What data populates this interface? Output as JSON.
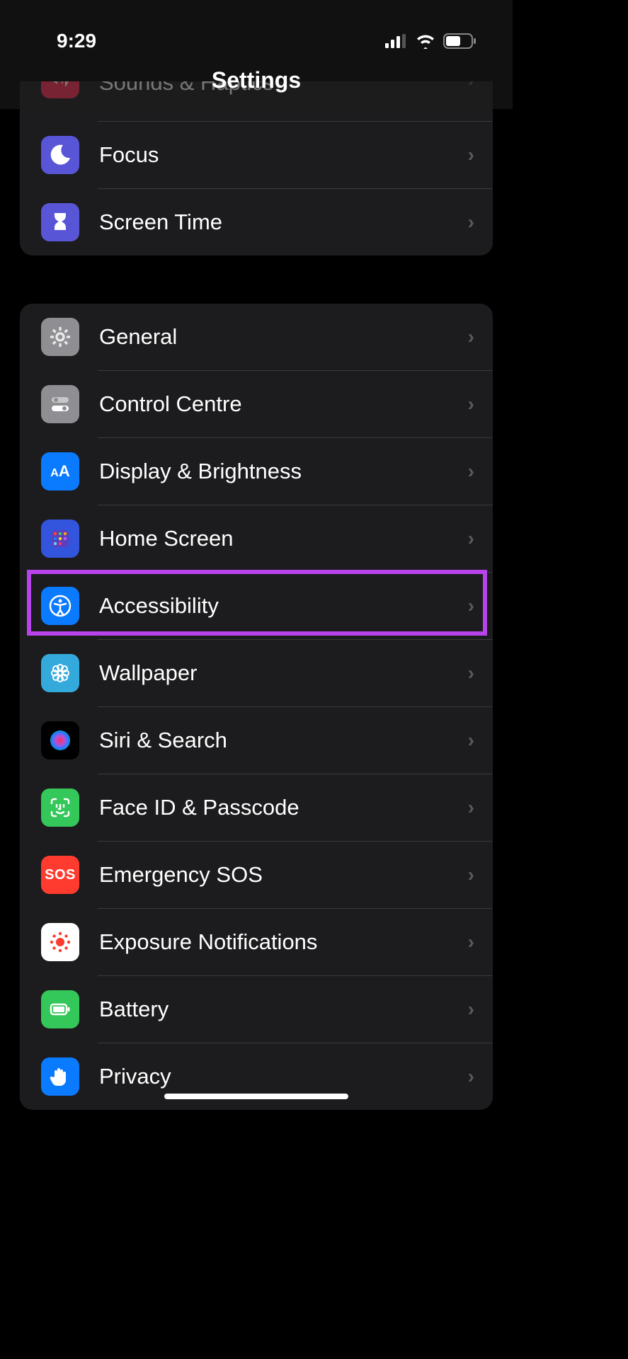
{
  "status": {
    "time": "9:29"
  },
  "header": {
    "title": "Settings"
  },
  "sections": [
    {
      "rows": [
        {
          "label": "Sounds & Haptics",
          "icon": "sounds-haptics-icon",
          "bg": "#ff2d55"
        },
        {
          "label": "Focus",
          "icon": "moon-icon",
          "bg": "#5856d6"
        },
        {
          "label": "Screen Time",
          "icon": "hourglass-icon",
          "bg": "#5856d6"
        }
      ]
    },
    {
      "rows": [
        {
          "label": "General",
          "icon": "gear-icon",
          "bg": "#8e8e93"
        },
        {
          "label": "Control Centre",
          "icon": "switches-icon",
          "bg": "#8e8e93"
        },
        {
          "label": "Display & Brightness",
          "icon": "aa-icon",
          "bg": "#0a7aff"
        },
        {
          "label": "Home Screen",
          "icon": "home-screen-icon",
          "bg": "#3355dd"
        },
        {
          "label": "Accessibility",
          "icon": "accessibility-icon",
          "bg": "#0a7aff",
          "highlighted": true
        },
        {
          "label": "Wallpaper",
          "icon": "flower-icon",
          "bg": "#34aadc"
        },
        {
          "label": "Siri & Search",
          "icon": "siri-icon",
          "bg": "#000"
        },
        {
          "label": "Face ID & Passcode",
          "icon": "faceid-icon",
          "bg": "#34c759"
        },
        {
          "label": "Emergency SOS",
          "icon": "sos-icon",
          "bg": "#ff3b30"
        },
        {
          "label": "Exposure Notifications",
          "icon": "exposure-icon",
          "bg": "#fff"
        },
        {
          "label": "Battery",
          "icon": "battery-icon",
          "bg": "#34c759"
        },
        {
          "label": "Privacy",
          "icon": "hand-icon",
          "bg": "#0a7aff"
        }
      ]
    }
  ],
  "highlight_color": "#b843ea"
}
